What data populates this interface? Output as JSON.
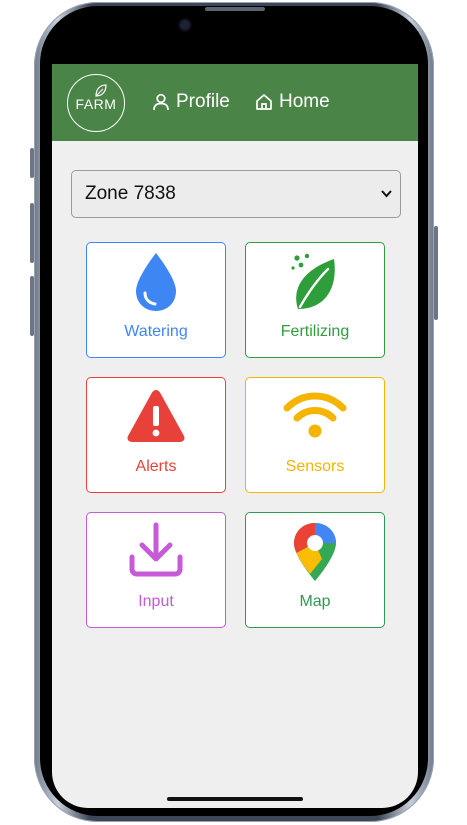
{
  "header": {
    "logo_text": "FARM",
    "nav": [
      {
        "label": "Profile",
        "icon": "person-icon"
      },
      {
        "label": "Home",
        "icon": "home-icon"
      }
    ]
  },
  "zone_select": {
    "value": "Zone 7838"
  },
  "tiles": [
    {
      "label": "Watering",
      "icon": "water-drop-icon",
      "color": "#3f86f5"
    },
    {
      "label": "Fertilizing",
      "icon": "leaf-icon",
      "color": "#2e9e3a"
    },
    {
      "label": "Alerts",
      "icon": "warning-icon",
      "color": "#e8413a"
    },
    {
      "label": "Sensors",
      "icon": "wifi-icon",
      "color": "#f4b400"
    },
    {
      "label": "Input",
      "icon": "download-icon",
      "color": "#c65ad8"
    },
    {
      "label": "Map",
      "icon": "map-pin-icon",
      "color": "#2d9a52"
    }
  ],
  "colors": {
    "header_bg": "#4a8447",
    "screen_bg": "#efeff0"
  }
}
